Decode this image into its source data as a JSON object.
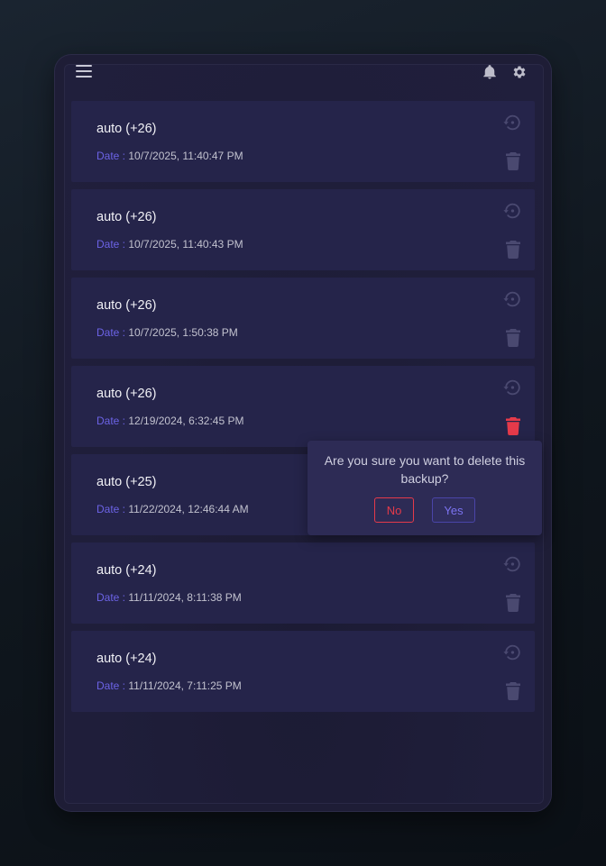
{
  "colors": {
    "accent": "#6c63e6",
    "danger": "#e53a4a",
    "icon_muted": "#4a4970",
    "card_bg": "#25244a"
  },
  "header": {
    "menu_icon": "hamburger-menu-icon",
    "notifications_icon": "bell-icon",
    "settings_icon": "gear-icon"
  },
  "backups": [
    {
      "title": "auto (+26)",
      "date_label": "Date :",
      "date": "10/7/2025, 11:40:47 PM"
    },
    {
      "title": "auto (+26)",
      "date_label": "Date :",
      "date": "10/7/2025, 11:40:43 PM"
    },
    {
      "title": "auto (+26)",
      "date_label": "Date :",
      "date": "10/7/2025, 1:50:38 PM"
    },
    {
      "title": "auto (+26)",
      "date_label": "Date :",
      "date": "12/19/2024, 6:32:45 PM"
    },
    {
      "title": "auto (+25)",
      "date_label": "Date :",
      "date": "11/22/2024, 12:46:44 AM"
    },
    {
      "title": "auto (+24)",
      "date_label": "Date :",
      "date": "11/11/2024, 8:11:38 PM"
    },
    {
      "title": "auto (+24)",
      "date_label": "Date :",
      "date": "11/11/2024, 7:11:25 PM"
    }
  ],
  "confirm_dialog": {
    "message": "Are you sure you want to delete this backup?",
    "no_label": "No",
    "yes_label": "Yes"
  }
}
